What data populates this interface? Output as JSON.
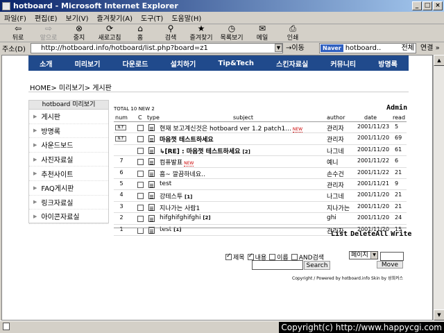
{
  "window": {
    "title": "hotboard - Microsoft Internet Explorer",
    "buttons": [
      "_",
      "□",
      "×"
    ]
  },
  "menubar": [
    "파일(F)",
    "편집(E)",
    "보기(V)",
    "즐겨찾기(A)",
    "도구(T)",
    "도움말(H)"
  ],
  "toolbar": [
    {
      "label": "뒤로",
      "icon": "back-arrow-icon",
      "glyph": "⇦"
    },
    {
      "label": "앞으로",
      "icon": "forward-arrow-icon",
      "glyph": "⇨"
    },
    {
      "label": "중지",
      "icon": "stop-icon",
      "glyph": "⊗"
    },
    {
      "label": "새로고침",
      "icon": "refresh-icon",
      "glyph": "⟳"
    },
    {
      "label": "홈",
      "icon": "home-icon",
      "glyph": "⌂"
    },
    {
      "label": "검색",
      "icon": "search-icon",
      "glyph": "⚲"
    },
    {
      "label": "즐겨찾기",
      "icon": "favorites-icon",
      "glyph": "★"
    },
    {
      "label": "목록보기",
      "icon": "history-icon",
      "glyph": "◷"
    },
    {
      "label": "메일",
      "icon": "mail-icon",
      "glyph": "✉"
    },
    {
      "label": "인쇄",
      "icon": "print-icon",
      "glyph": "⎙"
    }
  ],
  "address": {
    "label": "주소(D)",
    "url": "http://hotboard.info/hotboard/list.php?board=z1",
    "go": "→이동",
    "naver_logo": "Naver",
    "naver_value": "hotboard..",
    "naver_all": "전체",
    "links": "연결 »"
  },
  "site_nav": [
    "소개",
    "미리보기",
    "다운로드",
    "설치하기",
    "Tip&Tech",
    "스킨자료실",
    "커뮤니티",
    "방명록"
  ],
  "breadcrumb": "HOME> 미리보기> 게시판",
  "sidebar": {
    "title": "hotboard 미리보기",
    "items": [
      "게시판",
      "방명록",
      "사운드보드",
      "사진자료실",
      "추천사이트",
      "FAQ게시판",
      "링크자료실",
      "아이콘자료실"
    ]
  },
  "board": {
    "total": "TOTAL 10 NEW 2",
    "admin": "Admin",
    "columns": {
      "num": "num",
      "c": "C",
      "type": "type",
      "subject": "subject",
      "author": "author",
      "date": "date",
      "read": "read"
    },
    "rows": [
      {
        "num": "N.T",
        "notice": true,
        "subject": "현재 보고계신것은 hotboard ver 1.2 patch1...",
        "bold": false,
        "comments": "",
        "new": true,
        "author": "관리자",
        "date": "2001/11/23",
        "read": "5"
      },
      {
        "num": "N.T",
        "notice": true,
        "subject": "마음껏 테스트하세요",
        "bold": true,
        "comments": "",
        "new": false,
        "author": "관리자",
        "date": "2001/11/20",
        "read": "69"
      },
      {
        "num": "",
        "notice": false,
        "subject": "↳[RE] : 마음껏 테스트하세요",
        "bold": true,
        "comments": "[2]",
        "new": false,
        "author": "나그네",
        "date": "2001/11/20",
        "read": "61"
      },
      {
        "num": "7",
        "notice": false,
        "subject": "컴퓨발표",
        "bold": false,
        "comments": "",
        "new": true,
        "author": "예니",
        "date": "2001/11/22",
        "read": "6"
      },
      {
        "num": "6",
        "notice": false,
        "subject": "흠~ 깔끔하네요..",
        "bold": false,
        "comments": "",
        "new": false,
        "author": "손수건",
        "date": "2001/11/22",
        "read": "21"
      },
      {
        "num": "5",
        "notice": false,
        "subject": "test",
        "bold": false,
        "comments": "",
        "new": false,
        "author": "관리자",
        "date": "2001/11/21",
        "read": "9"
      },
      {
        "num": "4",
        "notice": false,
        "subject": "강테스투",
        "bold": false,
        "comments": "[1]",
        "new": false,
        "author": "나그네",
        "date": "2001/11/20",
        "read": "21"
      },
      {
        "num": "3",
        "notice": false,
        "subject": "지나가는 사람1",
        "bold": false,
        "comments": "",
        "new": false,
        "author": "지나가는",
        "date": "2001/11/20",
        "read": "21"
      },
      {
        "num": "2",
        "notice": false,
        "subject": "hifghifghifghi",
        "bold": false,
        "comments": "[2]",
        "new": false,
        "author": "ghi",
        "date": "2001/11/20",
        "read": "24"
      },
      {
        "num": "1",
        "notice": false,
        "subject": "test",
        "bold": false,
        "comments": "[1]",
        "new": false,
        "author": "관리자",
        "date": "2001/11/20",
        "read": "15"
      }
    ],
    "new_tag": "NEW",
    "actions": [
      "List",
      "DeleteAll",
      "Write"
    ]
  },
  "search": {
    "options": [
      {
        "label": "제목",
        "checked": true
      },
      {
        "label": "내용",
        "checked": true
      },
      {
        "label": "이름",
        "checked": false
      },
      {
        "label": "AND검색",
        "checked": false
      }
    ],
    "button": "Search",
    "page_select": "페이지",
    "move_button": "Move"
  },
  "footer": "Copyright / Powered by hotboard.info Skin by 성희커스",
  "copyright_overlay": "Copyright(c) http://www.happycgi.com"
}
